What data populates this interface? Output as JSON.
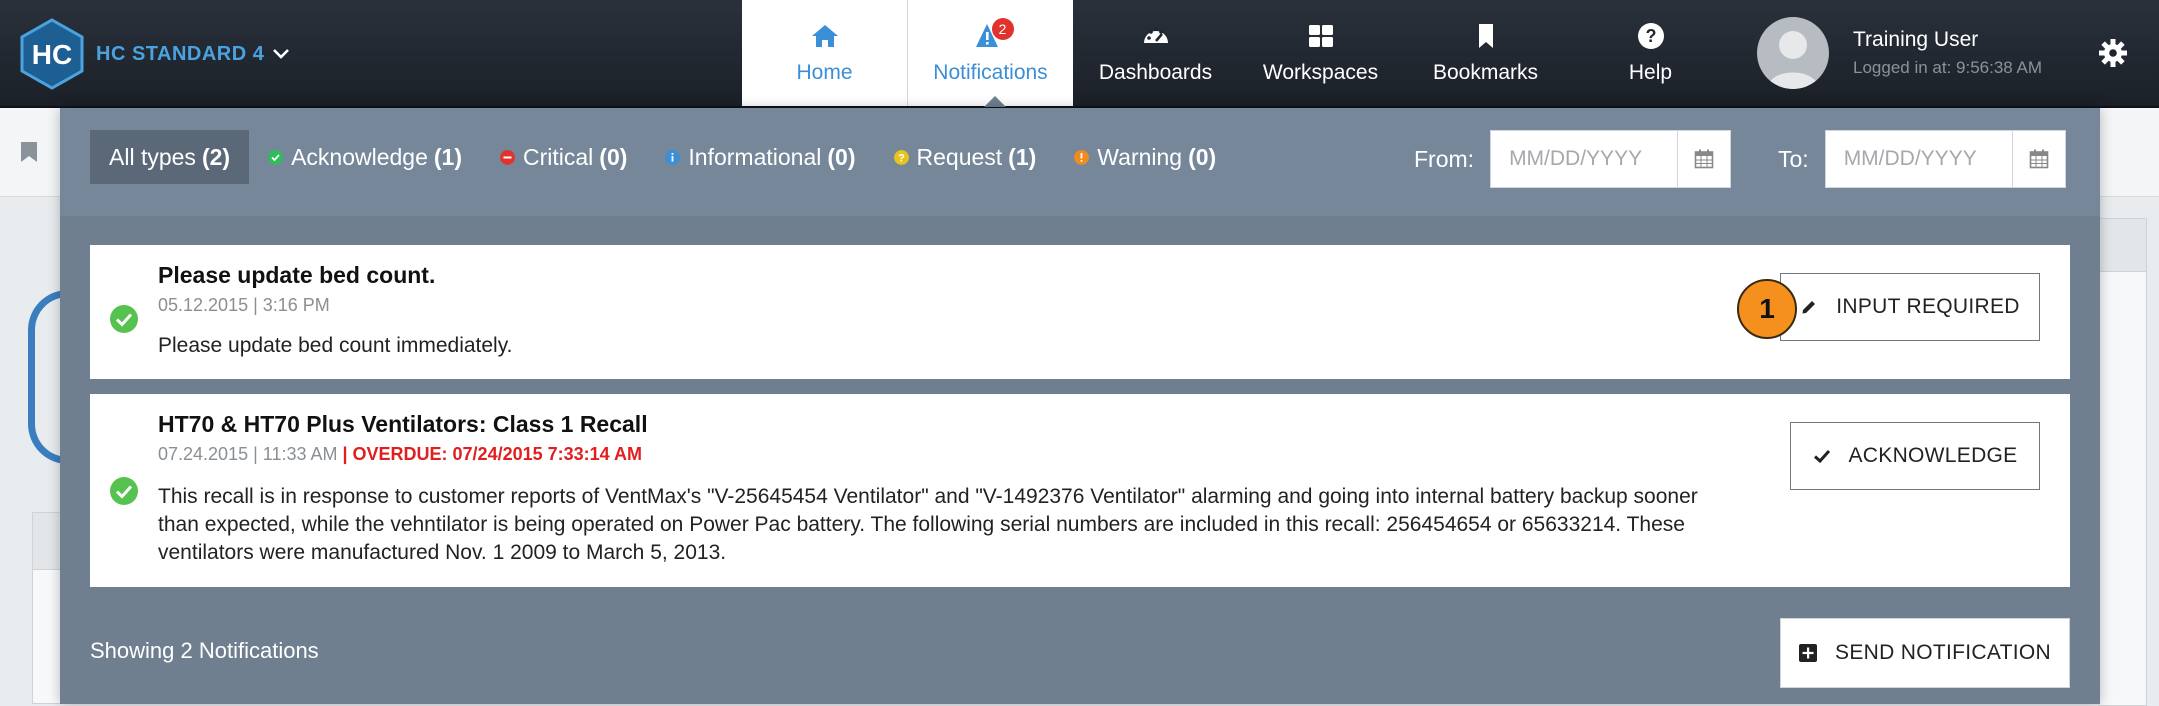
{
  "app": {
    "brand": "HC STANDARD 4",
    "logo_text": "HC"
  },
  "nav": [
    {
      "label": "Home",
      "icon": "home-icon"
    },
    {
      "label": "Notifications",
      "icon": "alert-icon",
      "badge": "2"
    },
    {
      "label": "Dashboards",
      "icon": "dashboard-icon"
    },
    {
      "label": "Workspaces",
      "icon": "grid-icon"
    },
    {
      "label": "Bookmarks",
      "icon": "bookmark-icon"
    },
    {
      "label": "Help",
      "icon": "help-icon"
    }
  ],
  "user": {
    "name": "Training User",
    "login_time": "Logged in at: 9:56:38 AM"
  },
  "filters": [
    {
      "label": "All types",
      "count": "(2)",
      "color": ""
    },
    {
      "label": "Acknowledge",
      "count": "(1)",
      "color": "#2ebd59"
    },
    {
      "label": "Critical",
      "count": "(0)",
      "color": "#e0332e"
    },
    {
      "label": "Informational",
      "count": "(0)",
      "color": "#3b8fd6"
    },
    {
      "label": "Request",
      "count": "(1)",
      "color": "#e8c21e"
    },
    {
      "label": "Warning",
      "count": "(0)",
      "color": "#f08c1e"
    }
  ],
  "date_filters": {
    "from_label": "From:",
    "from_placeholder": "MM/DD/YYYY",
    "to_label": "To:",
    "to_placeholder": "MM/DD/YYYY"
  },
  "notifications": [
    {
      "title": "Please update bed count.",
      "date": "05.12.2015 | 3:16 PM",
      "overdue": "",
      "body": "Please update bed count immediately.",
      "action": "INPUT REQUIRED",
      "step": "1"
    },
    {
      "title": "HT70 & HT70 Plus Ventilators: Class 1 Recall",
      "date": "07.24.2015 | 11:33 AM",
      "overdue": " | OVERDUE: 07/24/2015 7:33:14 AM",
      "body": "This recall is in response to customer reports of VentMax's \"V-25645454 Ventilator\" and \"V-1492376 Ventilator\" alarming and going into internal battery backup sooner than expected, while the vehntilator is being operated on Power Pac battery. The following serial numbers are included in this recall: 256454654 or 65633214. These ventilators were manufactured Nov. 1 2009 to March 5, 2013.",
      "action": "ACKNOWLEDGE"
    }
  ],
  "footer": {
    "count_text": "Showing 2 Notifications",
    "send_label": "SEND NOTIFICATION"
  },
  "colors": {
    "accent": "#3b8fd6",
    "panel": "#6f7f8f",
    "filterbar": "#76879a",
    "navbar": "#1f252d",
    "step_badge": "#f5901e"
  }
}
